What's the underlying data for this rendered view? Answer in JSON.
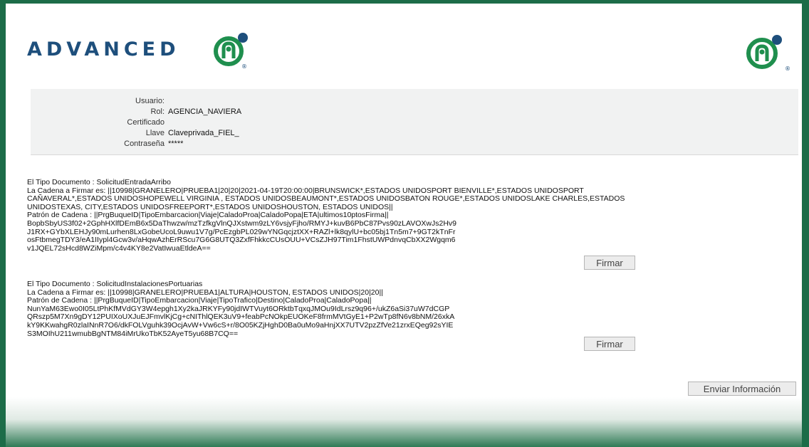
{
  "brand": {
    "name": "ADVANCED",
    "registered": "®"
  },
  "info": {
    "usuario_label": "Usuario:",
    "usuario_value": "",
    "rol_label": "Rol:",
    "rol_value": "AGENCIA_NAVIERA",
    "certificado_label": "Certificado",
    "certificado_value": "",
    "llave_label": "Llave",
    "llave_value": "Claveprivada_FIEL_",
    "contrasena_label": "Contraseña",
    "contrasena_value": "*****"
  },
  "documents": [
    {
      "tipo": "El Tipo Documento : SolicitudEntradaArribo",
      "cadena_lines": [
        "La Cadena a Firmar es: ||10998|GRANELERO|PRUEBA1|20|20|2021-04-19T20:00:00|BRUNSWICK*,ESTADOS UNIDOSPORT BIENVILLE*,ESTADOS UNIDOSPORT",
        "CAÑAVERAL*,ESTADOS UNIDOSHOPEWELL VIRGINIA , ESTADOS UNIDOSBEAUMONT*,ESTADOS UNIDOSBATON ROUGE*,ESTADOS UNIDOSLAKE CHARLES,ESTADOS",
        "UNIDOSTEXAS, CITY,ESTADOS UNIDOSFREEPORT*,ESTADOS UNIDOSHOUSTON, ESTADOS UNIDOS||"
      ],
      "patron": "Patrón de Cadena : ||PrgBuqueID|TipoEmbarcacion|Viaje|CaladoProa|CaladoPopa|ETA|ultimos10ptosFirma||",
      "firma_lines": [
        "BopbSbyUS3f02+2GphHXlfDEmB6x5DaThwzw/mzTzfkgVlnQJXstwm9zLY6vsjyFjho/RMYJ+kuvB6PbC87Pvs90zLAVOXwJs2Hv9",
        "J1RX+GYbXLEHJy90mLurhen8LxGobeUcoL9uwu1V7g/PcEzgbPL029wYNGqcjztXX+RAZl+lk8qylU+bc05bj1Tn5m7+9GT2kTnFr",
        "osFtbmegTDY3/eA1IIypl4Gcw3v/aHqwAzhErRScu7G6G8UTQ3ZxfFhkkcCUsOUU+VCsZJH97Tim1FhstUWPdnvqCbXX2Wgqm6",
        "v1JQEL72sHcd8WZiMpm/c4v4KY8e2VatIwuaEtldeA=="
      ],
      "button_label": "Firmar"
    },
    {
      "tipo": "El Tipo Documento : SolicitudInstalacionesPortuarias",
      "cadena_lines": [
        "La Cadena a Firmar es: ||10998|GRANELERO|PRUEBA1|ALTURA|HOUSTON, ESTADOS UNIDOS|20|20||"
      ],
      "patron": "Patrón de Cadena : ||PrgBuqueID|TipoEmbarcacion|Viaje|TipoTrafico|Destino|CaladoProa|CaladoPopa||",
      "firma_lines": [
        "NunYaM63Ewo0I05LtPhKfMVdGY3W4epgh1Xy2kaJRKYFy90jdIWTVuyt6ORktbTqxqJMOu9IdLrsz9q96+/ukZ6aSi37uW7dCGP",
        "QRszp5M7Xn9gDY12PUIXoUXJuEJFmvlKjCg+cNIThlQEK3uV9+feabPcNOkpEUOKeF8frmMVtGyE1+P2wTp8fN6v8bNM/26xkA",
        "kY9KKwahgR0zlaINnR7O6/dkFOLVguhk39OcjAvW+Vw6cS+r/8O05KZjHghD0Ba0uMo9aHnjXX7UTV2pzZfVe21zrxEQeg92sYIE",
        "S3MOIhU211wmubBgNTM84iMrUkoTbK52AyeT5yu68B7CQ=="
      ],
      "button_label": "Firmar"
    }
  ],
  "submit": {
    "label": "Enviar Información"
  },
  "colors": {
    "frame": "#1c6c48",
    "brand_blue": "#1e4f7c",
    "brand_green": "#1f8f4e"
  }
}
